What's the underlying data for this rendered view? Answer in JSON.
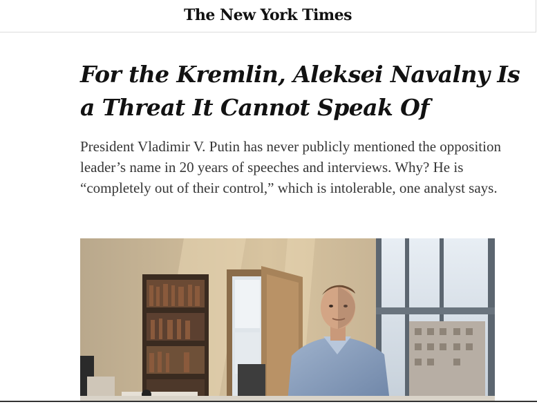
{
  "masthead": {
    "logo_text": "The New York Times"
  },
  "article": {
    "headline": "For the Kremlin, Aleksei Navalny Is a Threat It Cannot Speak Of",
    "summary": "President Vladimir V. Putin has never publicly mentioned the opposition leader’s name in 20 years of speeches and interviews. Why? He is “completely out of their control,” which is intolerable, one analyst says."
  },
  "colors": {
    "text": "#121212",
    "summary_text": "#363636",
    "rule": "#dcdcdc"
  },
  "icons": {
    "logo": "nyt-wordmark"
  }
}
